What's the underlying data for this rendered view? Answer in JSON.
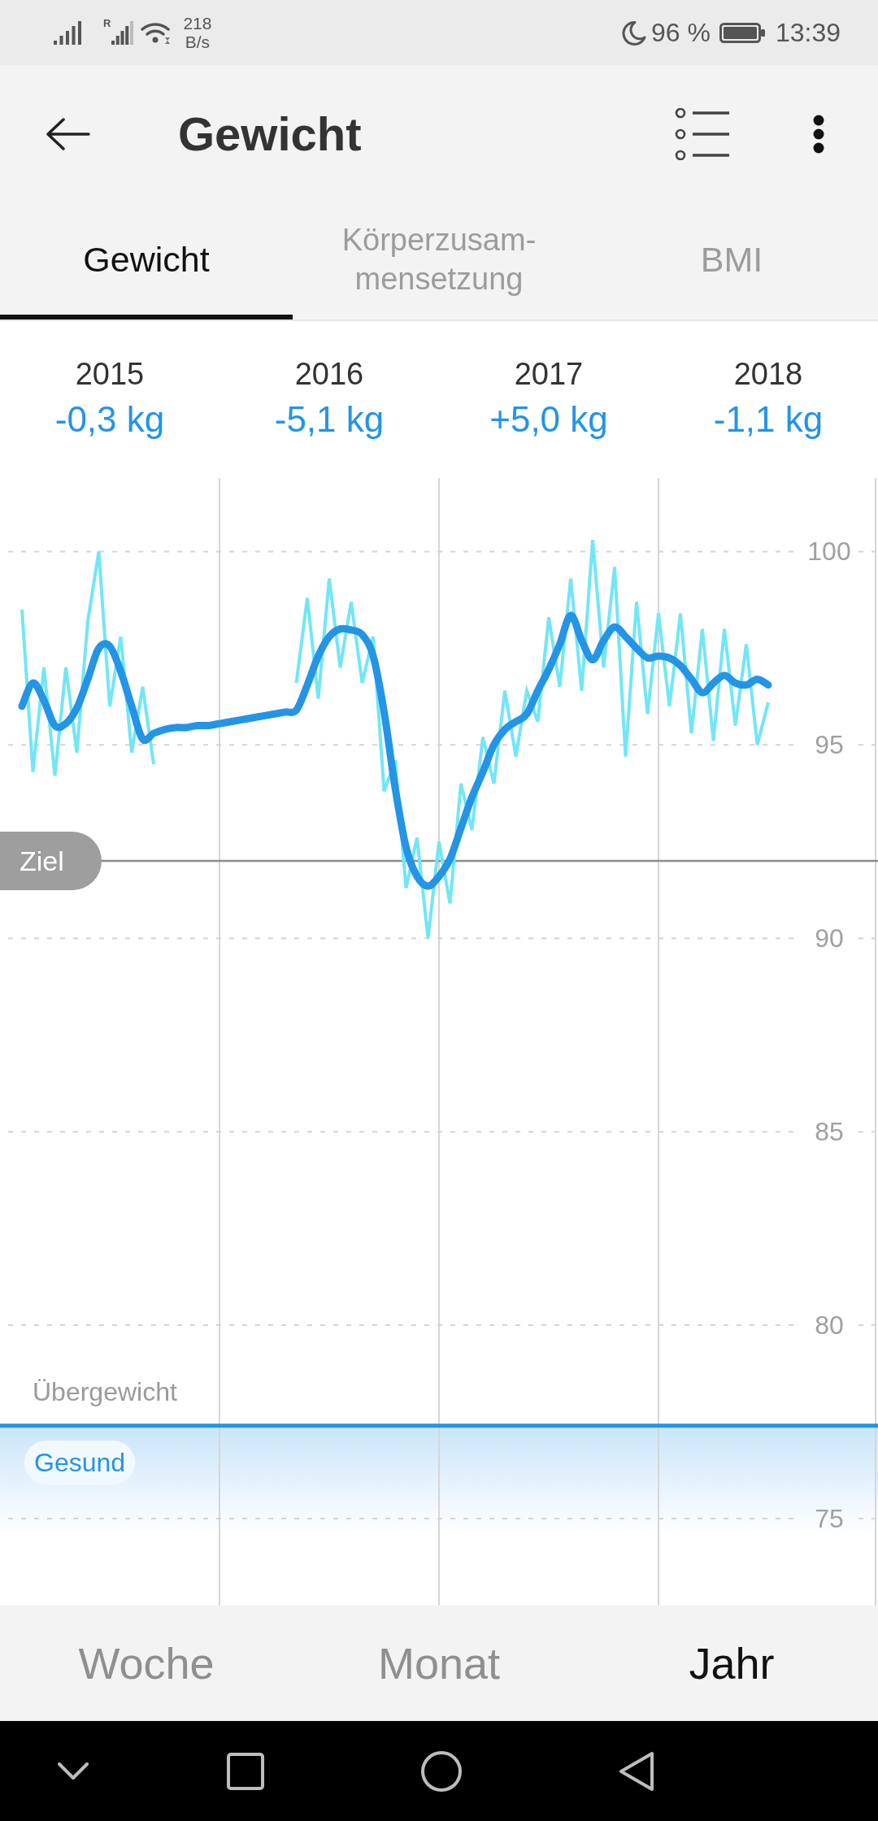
{
  "status_bar": {
    "roaming_mark": "R",
    "network_speed": {
      "value": "218",
      "unit": "B/s"
    },
    "battery": "96 %",
    "time": "13:39"
  },
  "header": {
    "title": "Gewicht"
  },
  "tabs": [
    {
      "label": "Gewicht",
      "selected": true
    },
    {
      "label": "Körperzusam-mensetzung",
      "selected": false
    },
    {
      "label": "BMI",
      "selected": false
    }
  ],
  "year_summary": [
    {
      "year": "2015",
      "change": "-0,3 kg"
    },
    {
      "year": "2016",
      "change": "-5,1 kg"
    },
    {
      "year": "2017",
      "change": "+5,0 kg"
    },
    {
      "year": "2018",
      "change": "-1,1 kg"
    }
  ],
  "chart": {
    "chart_data": {
      "type": "line",
      "ylim": [
        72.75,
        101.9
      ],
      "yticks": [
        75,
        80,
        85,
        90,
        95,
        100
      ],
      "grid": true,
      "categories": [
        null,
        null,
        null,
        null,
        null,
        null,
        null,
        null,
        null,
        null,
        null,
        null,
        null,
        null,
        null,
        null,
        null,
        null,
        null,
        null,
        null,
        null,
        null,
        null,
        null,
        null,
        null,
        null,
        null,
        null,
        null,
        null,
        null,
        null,
        null,
        null,
        null,
        null,
        null,
        null,
        null,
        null,
        null,
        null,
        null,
        null,
        null,
        null,
        null,
        null,
        null,
        null,
        null,
        null,
        null,
        null,
        null,
        null,
        null,
        null,
        null,
        null,
        null,
        null,
        null,
        null,
        null,
        null,
        null
      ],
      "series": [
        {
          "color": "#72e6f6",
          "values": [
            98.5,
            94.3,
            97.0,
            94.2,
            97.0,
            94.8,
            98.2,
            100.0,
            96.0,
            97.8,
            94.8,
            96.5,
            94.5,
            null,
            null,
            null,
            null,
            null,
            null,
            null,
            null,
            null,
            null,
            null,
            null,
            96.6,
            98.8,
            96.2,
            99.3,
            97.0,
            98.7,
            96.6,
            97.8,
            93.8,
            94.6,
            91.3,
            92.6,
            90.0,
            92.5,
            90.9,
            94.0,
            92.8,
            95.2,
            94.0,
            96.4,
            94.7,
            96.4,
            95.6,
            98.3,
            96.5,
            99.3,
            96.4,
            100.3,
            97.0,
            99.6,
            94.7,
            98.7,
            95.8,
            98.4,
            96.0,
            98.4,
            95.3,
            98.0,
            95.1,
            98.0,
            95.5,
            97.6,
            95.0,
            96.1
          ]
        },
        {
          "color": "#2394e6",
          "values": [
            96.0,
            96.6,
            96.15,
            95.5,
            95.55,
            95.95,
            96.7,
            97.5,
            97.55,
            96.9,
            96.0,
            95.15,
            95.3,
            95.4,
            95.45,
            95.45,
            95.5,
            95.5,
            95.55,
            95.6,
            95.65,
            95.7,
            95.75,
            95.8,
            95.85,
            95.9,
            96.55,
            97.3,
            97.8,
            98.0,
            97.97,
            97.85,
            97.3,
            95.85,
            93.9,
            92.35,
            91.6,
            91.35,
            91.6,
            92.05,
            92.85,
            93.65,
            94.3,
            95.0,
            95.4,
            95.6,
            95.8,
            96.4,
            96.95,
            97.6,
            98.35,
            97.7,
            97.2,
            97.7,
            98.05,
            97.8,
            97.5,
            97.25,
            97.3,
            97.25,
            97.05,
            96.7,
            96.35,
            96.6,
            96.8,
            96.6,
            96.55,
            96.7,
            96.55
          ]
        }
      ],
      "ref_lines": [
        {
          "axis": "y",
          "value": 92,
          "label": "Ziel"
        },
        {
          "axis": "y",
          "value": 77.4,
          "color": "#2394e6"
        }
      ],
      "bands": [
        {
          "axis": "y",
          "from": 72.75,
          "to": 77.4,
          "label": "Gesund",
          "color": "#2394e6"
        }
      ],
      "annotations": [
        "Übergewicht"
      ]
    }
  },
  "range_tabs": [
    {
      "label": "Woche",
      "selected": false
    },
    {
      "label": "Monat",
      "selected": false
    },
    {
      "label": "Jahr",
      "selected": true
    }
  ]
}
